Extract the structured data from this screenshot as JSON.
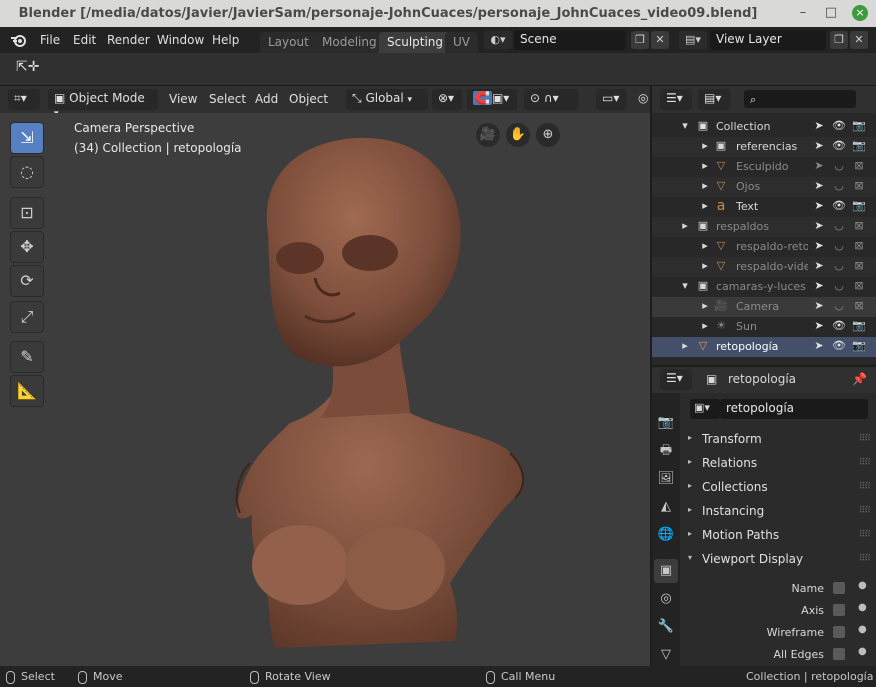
{
  "window": {
    "title": "Blender [/media/datos/Javier/JavierSam/personaje-JohnCuaces/personaje_JohnCuaces_video09.blend]",
    "minimize": "–",
    "maximize": "□",
    "close": "×"
  },
  "menubar": {
    "logo": "blender-logo",
    "items": [
      "File",
      "Edit",
      "Render",
      "Window",
      "Help"
    ],
    "workspaces": [
      "Layout",
      "Modeling",
      "Sculpting",
      "UV"
    ],
    "active_workspace": "Sculpting",
    "scene_name": "Scene",
    "view_layer_name": "View Layer"
  },
  "viewport_header": {
    "mode": "Object Mode",
    "menus": [
      "View",
      "Select",
      "Add",
      "Object"
    ],
    "orientation": "Global"
  },
  "viewport": {
    "camera_label": "Camera Perspective",
    "context_label": "(34) Collection | retopología",
    "bg_color": "#3d3d3d",
    "skin_color": "#8a5a45"
  },
  "outliner": {
    "rows": [
      {
        "name": "Collection",
        "type": "collection",
        "state": "normal"
      },
      {
        "name": "referencias",
        "type": "collection",
        "state": "normal"
      },
      {
        "name": "Esculpido",
        "type": "mesh",
        "state": "dim"
      },
      {
        "name": "Ojos",
        "type": "mesh",
        "state": "dim"
      },
      {
        "name": "Text",
        "type": "text",
        "state": "normal"
      },
      {
        "name": "respaldos",
        "type": "collection",
        "state": "dim"
      },
      {
        "name": "respaldo-retop",
        "type": "mesh",
        "state": "dim"
      },
      {
        "name": "respaldo-video",
        "type": "mesh",
        "state": "dim"
      },
      {
        "name": "camaras-y-luces",
        "type": "collection",
        "state": "dim"
      },
      {
        "name": "Camera",
        "type": "camera",
        "state": "dim"
      },
      {
        "name": "Sun",
        "type": "light",
        "state": "dim"
      },
      {
        "name": "retopología",
        "type": "mesh",
        "state": "selected"
      }
    ]
  },
  "properties": {
    "object_name": "retopología",
    "data_field": "retopología",
    "panels": [
      "Transform",
      "Relations",
      "Collections",
      "Instancing",
      "Motion Paths",
      "Viewport Display"
    ],
    "viewport_display_options": [
      "Name",
      "Axis",
      "Wireframe",
      "All Edges"
    ]
  },
  "statusbar": {
    "items": [
      "Select",
      "Move",
      "Rotate View",
      "Call Menu"
    ],
    "right_text": "Collection | retopología | V"
  }
}
